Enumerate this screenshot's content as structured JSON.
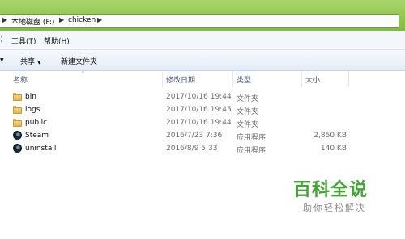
{
  "address": {
    "segments": [
      "本地磁盘 (F:)",
      "chicken"
    ]
  },
  "menu": {
    "items": [
      "工具(T)",
      "帮助(H)"
    ]
  },
  "toolbar": {
    "share_label": "共享",
    "new_folder_label": "新建文件夹"
  },
  "columns": {
    "name": "名称",
    "modified": "修改日期",
    "type": "类型",
    "size": "大小"
  },
  "files": [
    {
      "name": "bin",
      "modified": "2017/10/16 19:44",
      "type": "文件夹",
      "size": "",
      "icon": "folder-icon"
    },
    {
      "name": "logs",
      "modified": "2017/10/16 19:45",
      "type": "文件夹",
      "size": "",
      "icon": "folder-icon"
    },
    {
      "name": "public",
      "modified": "2017/10/16 19:44",
      "type": "文件夹",
      "size": "",
      "icon": "folder-icon"
    },
    {
      "name": "Steam",
      "modified": "2016/7/23 7:36",
      "type": "应用程序",
      "size": "2,850 KB",
      "icon": "steam-icon"
    },
    {
      "name": "uninstall",
      "modified": "2016/8/9 5:33",
      "type": "应用程序",
      "size": "140 KB",
      "icon": "steam-icon"
    }
  ],
  "watermark": {
    "title": "百科全说",
    "subtitle": "助你轻松解决"
  }
}
